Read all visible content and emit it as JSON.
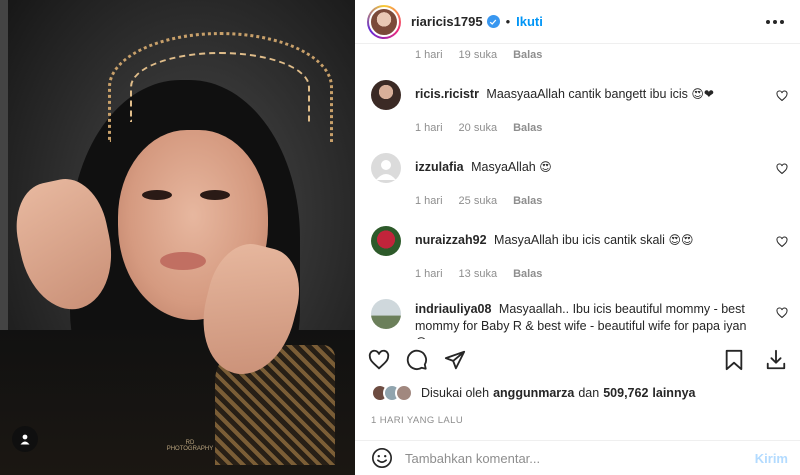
{
  "post": {
    "username": "riaricis1795",
    "follow_label": "Ikuti",
    "separator": "•",
    "photo_watermark": "RD PHOTOGRAPHY"
  },
  "comments": [
    {
      "meta": {
        "time": "1 hari",
        "likes": "19 suka",
        "reply": "Balas"
      }
    },
    {
      "user": "ricis.ricistr",
      "text": "MaasyaaAllah cantik bangett ibu icis",
      "emoji": "😍❤",
      "meta": {
        "time": "1 hari",
        "likes": "20 suka",
        "reply": "Balas"
      }
    },
    {
      "user": "izzulafia",
      "text": "MasyaAllah",
      "emoji": "😍",
      "meta": {
        "time": "1 hari",
        "likes": "25 suka",
        "reply": "Balas"
      }
    },
    {
      "user": "nuraizzah92",
      "text": "MasyaAllah ibu icis cantik skali",
      "emoji": "😍😍",
      "meta": {
        "time": "1 hari",
        "likes": "13 suka",
        "reply": "Balas"
      }
    },
    {
      "user": "indriauliya08",
      "text": "Masyaallah.. Ibu icis beautiful mommy - best mommy for Baby R & best wife - beautiful wife for papa iyan",
      "emoji": "😍❤"
    }
  ],
  "likes": {
    "prefix": "Disukai oleh",
    "user": "anggunmarza",
    "joiner": "dan",
    "count": "509,762",
    "suffix": "lainnya"
  },
  "timestamp": "1 HARI YANG LALU",
  "add_comment": {
    "placeholder": "Tambahkan komentar...",
    "post_label": "Kirim"
  },
  "icons": [
    "heart-icon",
    "comment-icon",
    "share-icon",
    "bookmark-icon",
    "download-icon",
    "more-icon",
    "emoji-icon",
    "verified-icon",
    "user-tag-icon"
  ],
  "colors": {
    "link": "#0095f6",
    "verified": "#3897f0",
    "post_disabled": "#b3dbff",
    "muted": "#8e8e8e"
  }
}
